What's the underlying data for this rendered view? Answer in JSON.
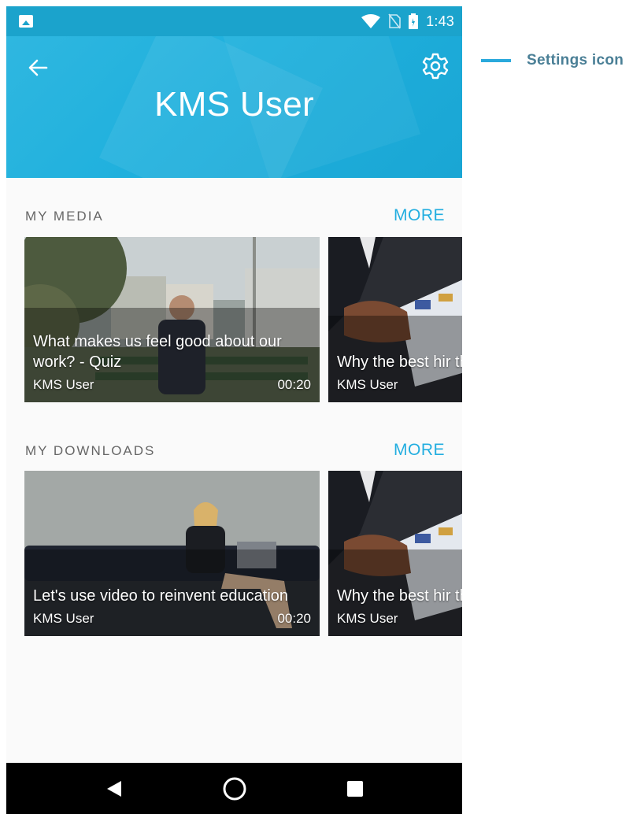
{
  "status_bar": {
    "time": "1:43",
    "icons": [
      "gallery-icon",
      "wifi-icon",
      "no-sim-icon",
      "battery-icon"
    ]
  },
  "header": {
    "title": "KMS User",
    "back_icon": "arrow-left-icon",
    "settings_icon": "gear-icon"
  },
  "sections": [
    {
      "title": "MY MEDIA",
      "more_label": "MORE",
      "cards": [
        {
          "title": "What makes us feel good about our work? - Quiz",
          "owner": "KMS User",
          "duration": "00:20"
        },
        {
          "title": "Why the best hir the perfect resu",
          "owner": "KMS User",
          "duration": ""
        }
      ]
    },
    {
      "title": "MY DOWNLOADS",
      "more_label": "MORE",
      "cards": [
        {
          "title": "Let's use video to reinvent education",
          "owner": "KMS User",
          "duration": "00:20"
        },
        {
          "title": "Why the best hir the perfect resu",
          "owner": "KMS User",
          "duration": ""
        }
      ]
    }
  ],
  "nav_bar": {
    "icons": [
      "back-triangle-icon",
      "home-circle-icon",
      "recents-square-icon"
    ]
  },
  "annotation": {
    "label": "Settings icon"
  },
  "colors": {
    "brand": "#1fb0dd",
    "accent": "#23aee0",
    "annotation": "#2aa9dc"
  }
}
